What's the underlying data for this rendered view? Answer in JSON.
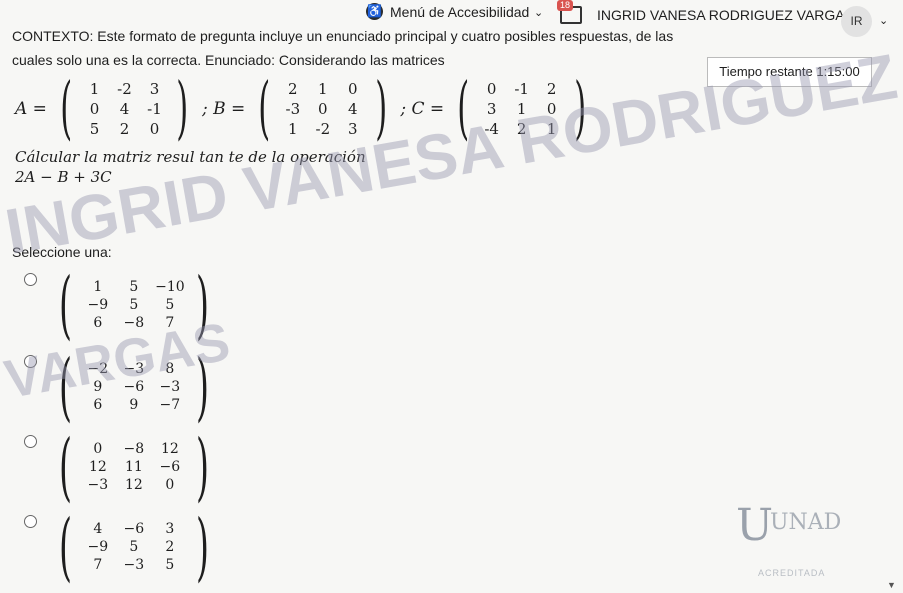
{
  "topbar": {
    "accessibility_menu": "Menú de Accesibilidad",
    "notification_count": "18",
    "user_name": "INGRID VANESA RODRIGUEZ VARGAS",
    "avatar_initials": "IR"
  },
  "question": {
    "context": "CONTEXTO: Este formato de pregunta incluye un enunciado principal y cuatro posibles respuestas, de las cuales solo una es la correcta. Enunciado: Considerando las matrices",
    "A_label": "A =",
    "B_label": "; B =",
    "C_label": "; C =",
    "A": [
      "1",
      "-2",
      "3",
      "0",
      "4",
      "-1",
      "5",
      "2",
      "0"
    ],
    "B": [
      "2",
      "1",
      "0",
      "-3",
      "0",
      "4",
      "1",
      "-2",
      "3"
    ],
    "C": [
      "0",
      "-1",
      "2",
      "3",
      "1",
      "0",
      "-4",
      "2",
      "1"
    ],
    "instruction": "Cálcular la matriz resul tan te de la operación",
    "expression": "2A − B + 3C"
  },
  "timer": {
    "label": "Tiempo restante 1:15:00"
  },
  "select_prompt": "Seleccione una:",
  "options": [
    [
      "1",
      "5",
      "−10",
      "−9",
      "5",
      "5",
      "6",
      "−8",
      "7"
    ],
    [
      "−2",
      "−3",
      "8",
      "9",
      "−6",
      "−3",
      "6",
      "9",
      "−7"
    ],
    [
      "0",
      "−8",
      "12",
      "12",
      "11",
      "−6",
      "−3",
      "12",
      "0"
    ],
    [
      "4",
      "−6",
      "3",
      "−9",
      "5",
      "2",
      "7",
      "−3",
      "5"
    ]
  ],
  "watermark": {
    "line1": "INGRID VANESA RODRIGUEZ",
    "line2": "VARGAS"
  },
  "logo": {
    "name": "UNAD",
    "subtitle": "ACREDITADA"
  }
}
